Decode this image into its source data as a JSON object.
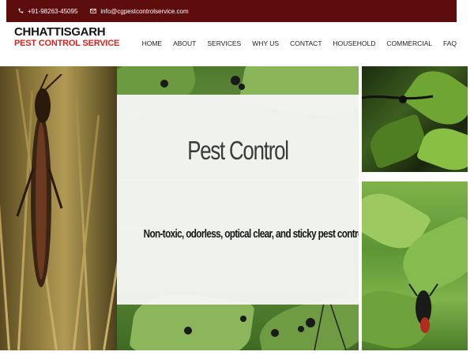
{
  "topbar": {
    "phone": "+91-98263-45095",
    "email": "info@cgpestcontrolservice.com"
  },
  "logo": {
    "line1": "CHHATTISGARH",
    "line2": "PEST CONTROL SERVICE"
  },
  "nav": {
    "items": [
      "HOME",
      "ABOUT",
      "SERVICES",
      "WHY US",
      "CONTACT",
      "HOUSEHOLD",
      "COMMERCIAL",
      "FAQ"
    ]
  },
  "hero": {
    "title": "Pest Control",
    "subtitle": "Non-toxic, odorless, optical clear, and sticky pest control products."
  },
  "colors": {
    "topbar_bg": "#5e0d0d",
    "logo_red": "#d8231f"
  },
  "icons": {
    "phone": "phone-icon",
    "email": "envelope-icon"
  }
}
